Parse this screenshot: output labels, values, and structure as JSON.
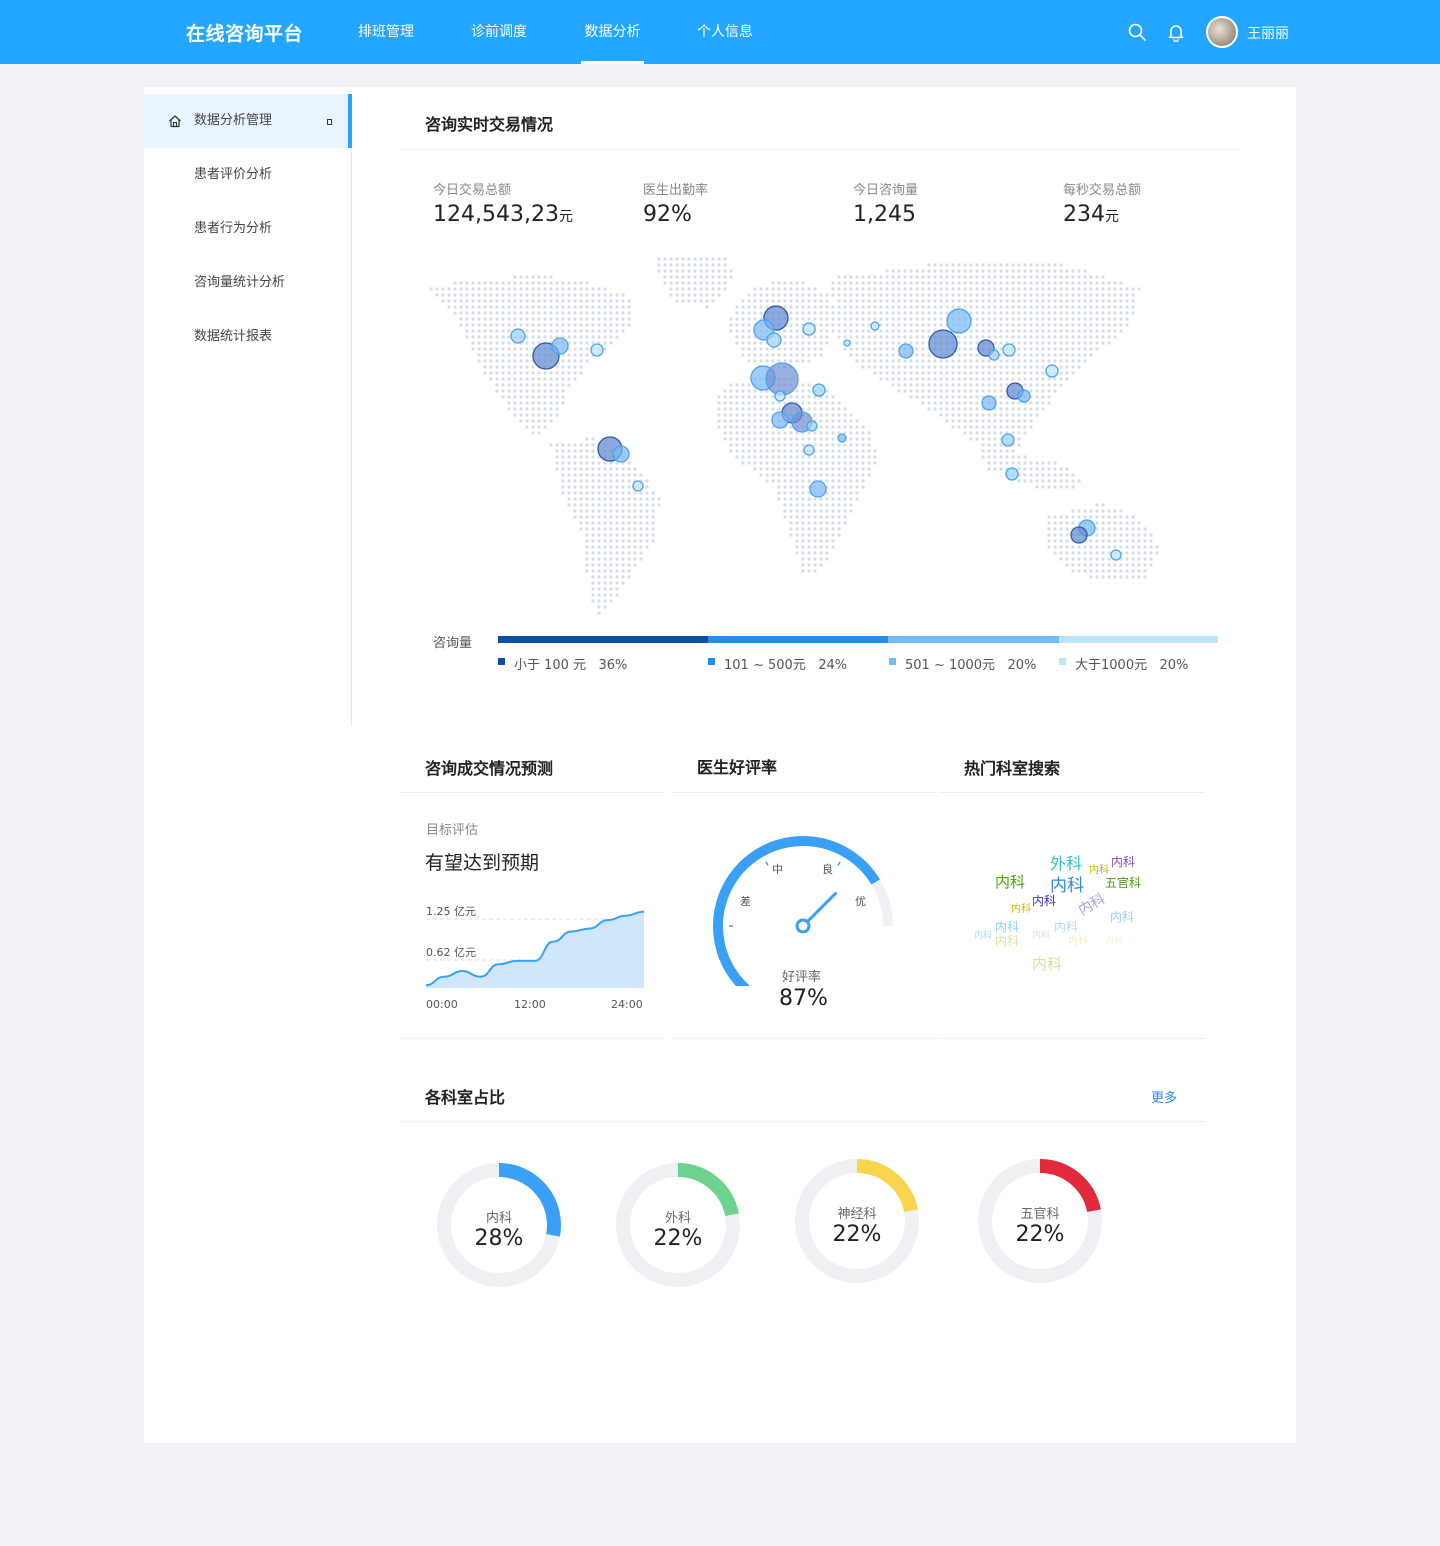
{
  "header": {
    "brand": "在线咨询平台",
    "nav": [
      "排班管理",
      "诊前调度",
      "数据分析",
      "个人信息"
    ],
    "active_nav": "数据分析",
    "username": "王丽丽",
    "icons": [
      "search-icon",
      "bell-icon"
    ]
  },
  "sidebar": {
    "items": [
      {
        "label": "数据分析管理",
        "active": true,
        "icon": "home-icon"
      },
      {
        "label": "患者评价分析"
      },
      {
        "label": "患者行为分析"
      },
      {
        "label": "咨询量统计分析"
      },
      {
        "label": "数据统计报表"
      }
    ]
  },
  "realtime": {
    "title": "咨询实时交易情况",
    "stats": [
      {
        "label": "今日交易总额",
        "value": "124,543,23",
        "unit": "元"
      },
      {
        "label": "医生出勤率",
        "value": "92%",
        "unit": ""
      },
      {
        "label": "今日咨询量",
        "value": "1,245",
        "unit": ""
      },
      {
        "label": "每秒交易总额",
        "value": "234",
        "unit": "元"
      }
    ],
    "legend_title": "咨询量",
    "legend": [
      {
        "label": "小于 100 元",
        "pct": "36%",
        "share": 36,
        "color": "#0b4ea8"
      },
      {
        "label": "101 ~ 500元",
        "pct": "24%",
        "share": 24,
        "color": "#1e90f5"
      },
      {
        "label": "501 ~ 1000元",
        "pct": "20%",
        "share": 20,
        "color": "#6fbff2"
      },
      {
        "label": "大于1000元",
        "pct": "20%",
        "share": 20,
        "color": "#bfe3fb"
      }
    ]
  },
  "forecast": {
    "title": "咨询成交情况预测",
    "label": "目标评估",
    "text": "有望达到预期",
    "chart_data": {
      "type": "area",
      "y_ticks": [
        "1.25 亿元",
        "0.62 亿元"
      ],
      "x_ticks": [
        "00:00",
        "12:00",
        "24:00"
      ],
      "x": [
        0,
        2,
        4,
        6,
        8,
        10,
        12,
        14,
        16,
        18,
        20,
        22,
        24
      ],
      "values": [
        0.05,
        0.2,
        0.3,
        0.2,
        0.42,
        0.48,
        0.48,
        0.82,
        1.0,
        1.05,
        1.2,
        1.28,
        1.35
      ],
      "ylim": [
        0,
        1.45
      ]
    }
  },
  "rating": {
    "title": "医生好评率",
    "scale": [
      "差",
      "中",
      "良",
      "优"
    ],
    "label": "好评率",
    "value": "87%",
    "fraction": 0.87,
    "color": "#3aa0f7"
  },
  "hot": {
    "title": "热门科室搜索",
    "words": [
      {
        "t": "外科",
        "c": "#2ec4c0"
      },
      {
        "t": "内科",
        "c": "#8a4ac9"
      },
      {
        "t": "内科",
        "c": "#c7b300"
      },
      {
        "t": "内科",
        "c": "#4aa800"
      },
      {
        "t": "内科",
        "c": "#2d8ae3"
      },
      {
        "t": "五官科",
        "c": "#4a9f00"
      },
      {
        "t": "内科",
        "c": "#3a2ed1"
      },
      {
        "t": "内科",
        "c": "#d4b800"
      },
      {
        "t": "内科",
        "c": "#b19ee8"
      },
      {
        "t": "内科",
        "c": "#9ccff5"
      },
      {
        "t": "内科",
        "c": "#8ed0f2"
      },
      {
        "t": "内科",
        "c": "#b4ddf6"
      },
      {
        "t": "内科",
        "c": "#cfe9a6"
      },
      {
        "t": "内科",
        "c": "#a9d9f3"
      },
      {
        "t": "内科",
        "c": "#c7e4f4"
      },
      {
        "t": "内科",
        "c": "#f5edb8"
      },
      {
        "t": "内科",
        "c": "#f6f1c6"
      },
      {
        "t": "内科",
        "c": "#cbe5a9"
      }
    ]
  },
  "departments": {
    "title": "各科室占比",
    "more": "更多",
    "items": [
      {
        "name": "内科",
        "value": "28%",
        "fraction": 0.28,
        "color": "#3aa0f7"
      },
      {
        "name": "外科",
        "value": "22%",
        "fraction": 0.22,
        "color": "#6dd28f"
      },
      {
        "name": "神经科",
        "value": "22%",
        "fraction": 0.22,
        "color": "#f9d54f"
      },
      {
        "name": "五官科",
        "value": "22%",
        "fraction": 0.22,
        "color": "#e12a3c"
      }
    ]
  }
}
